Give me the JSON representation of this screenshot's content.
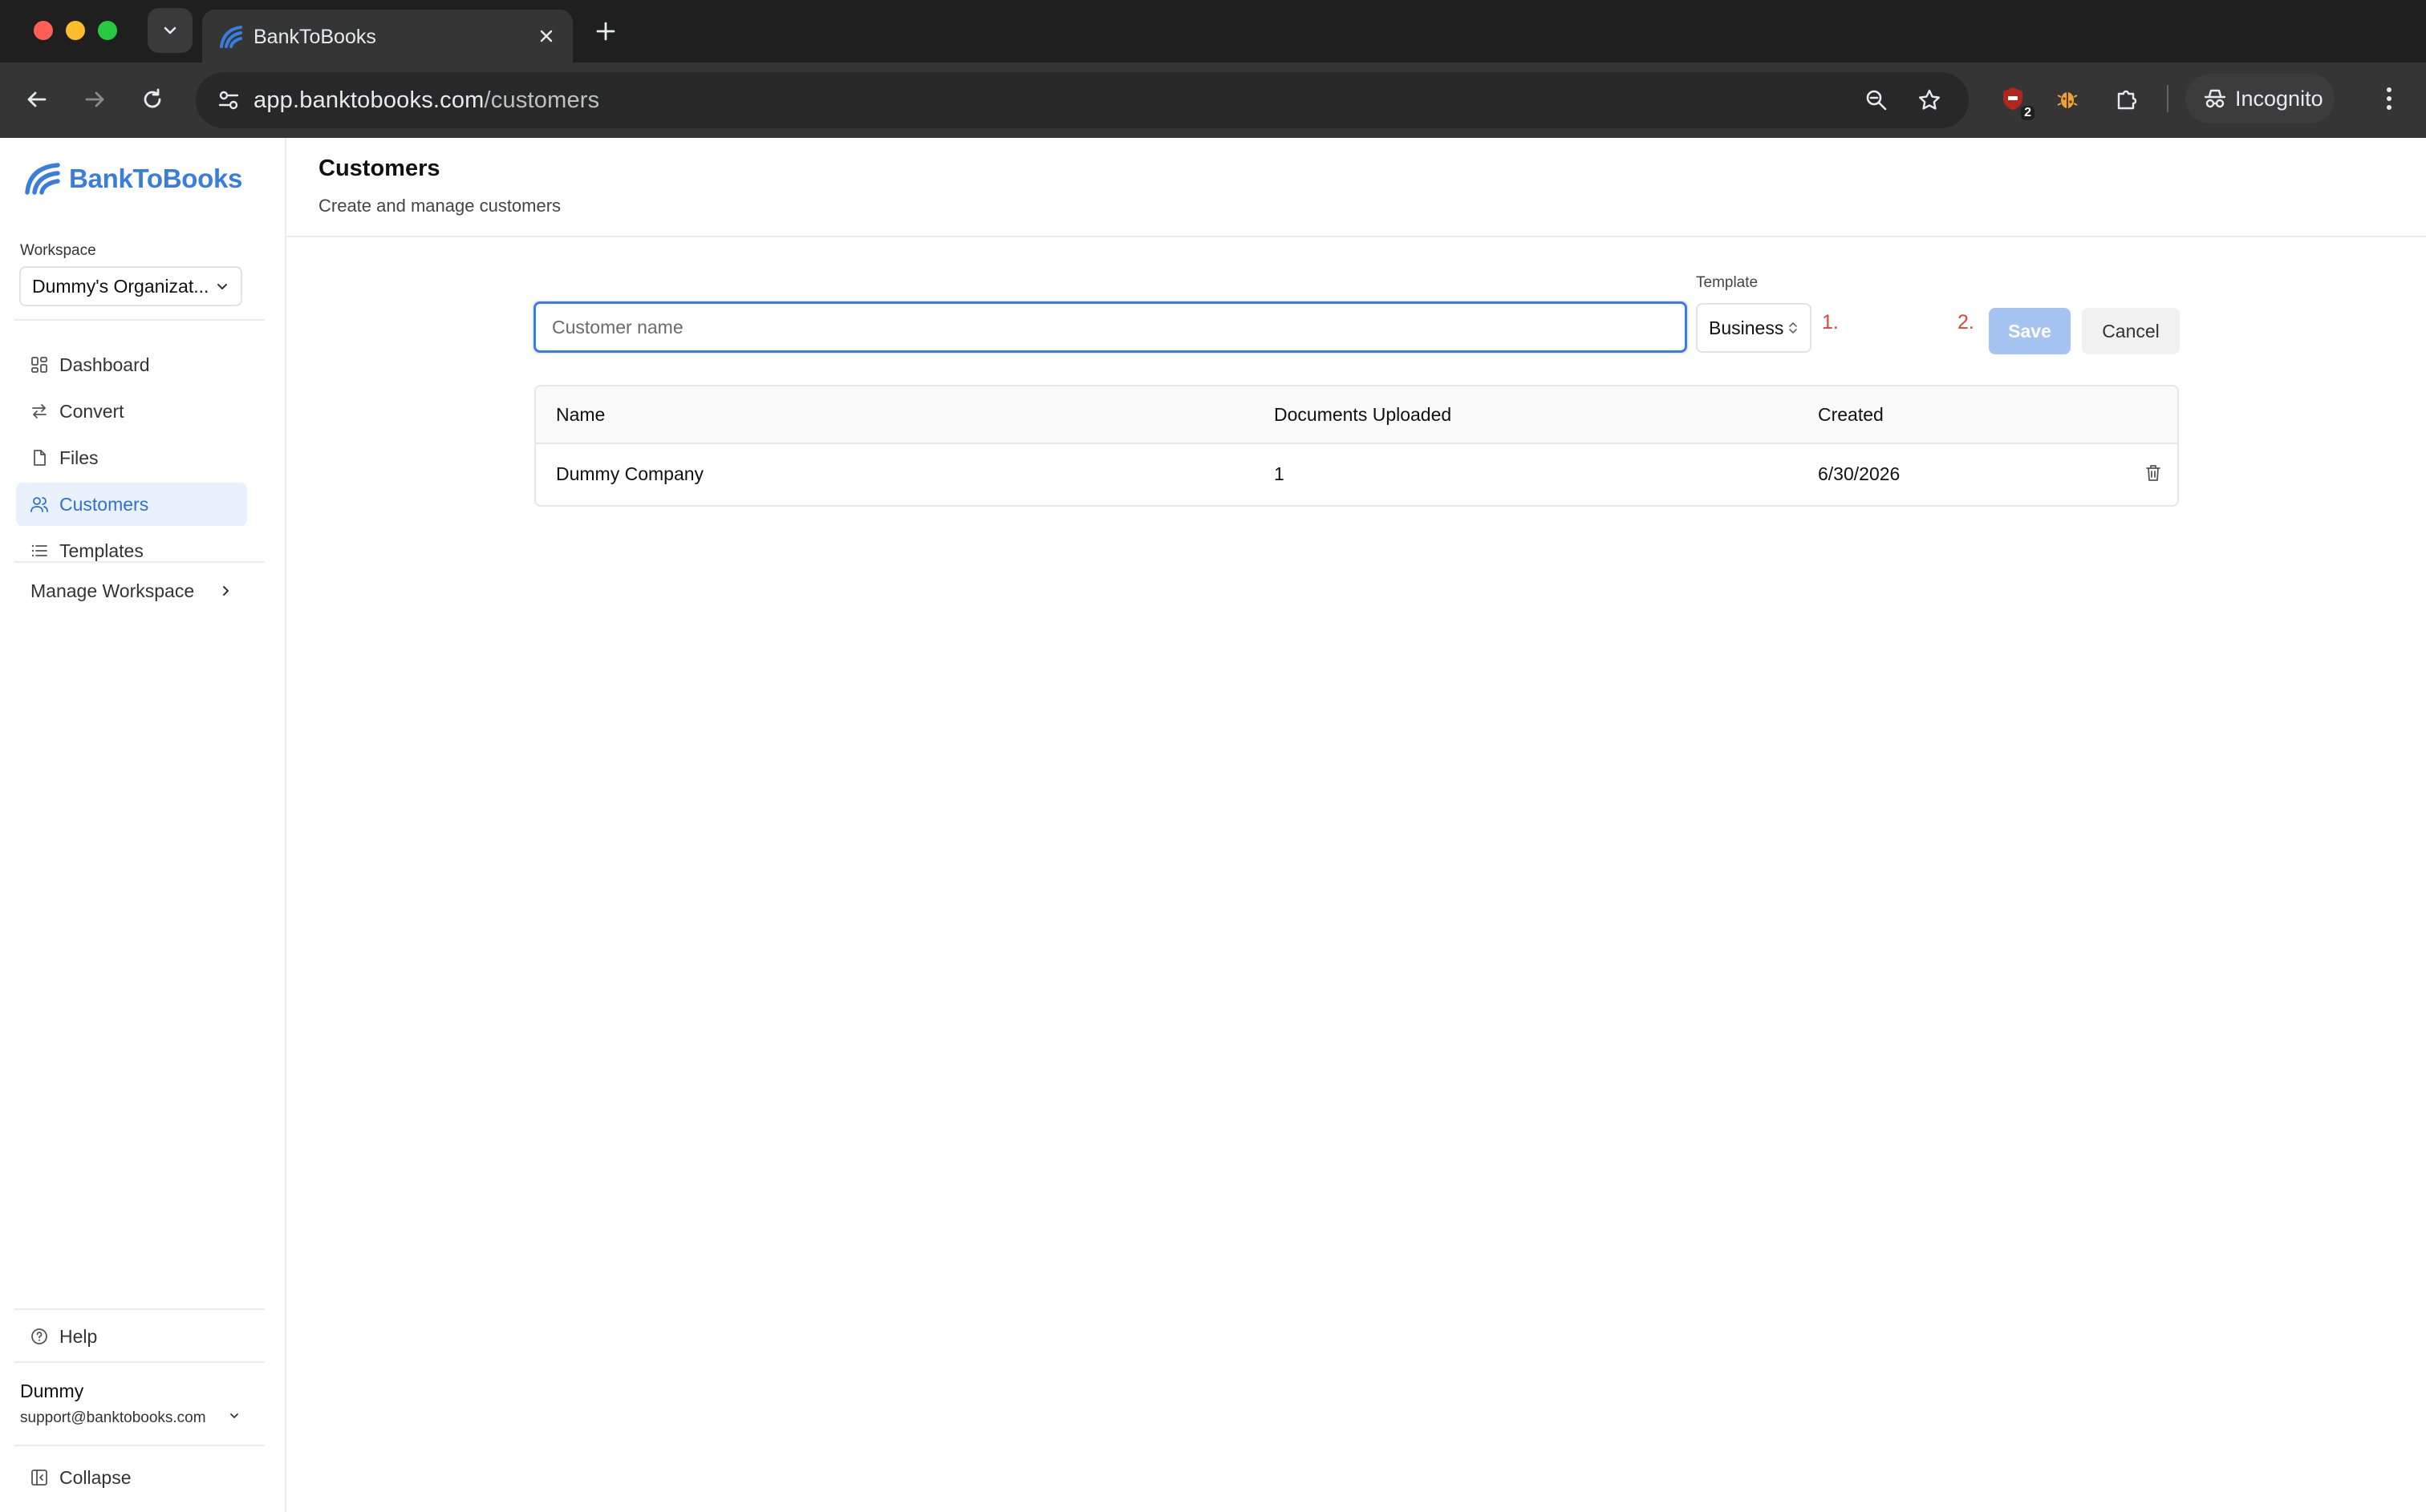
{
  "browser": {
    "tab_title": "BankToBooks",
    "url_host": "app.banktobooks.com",
    "url_path": "/customers",
    "extension_badge": "2",
    "incognito_label": "Incognito"
  },
  "sidebar": {
    "brand": "BankToBooks",
    "workspace_label": "Workspace",
    "workspace_value": "Dummy's Organizat...",
    "items": [
      {
        "label": "Dashboard",
        "icon": "dashboard-icon"
      },
      {
        "label": "Convert",
        "icon": "convert-icon"
      },
      {
        "label": "Files",
        "icon": "file-icon"
      },
      {
        "label": "Customers",
        "icon": "users-icon",
        "active": true
      },
      {
        "label": "Templates",
        "icon": "list-icon"
      }
    ],
    "manage_workspace": "Manage Workspace",
    "help": "Help",
    "user_name": "Dummy",
    "user_email": "support@banktobooks.com",
    "collapse": "Collapse"
  },
  "header": {
    "title": "Customers",
    "subtitle": "Create and manage customers"
  },
  "form": {
    "name_placeholder": "Customer name",
    "name_value": "",
    "template_label": "Template",
    "template_value": "Business",
    "annotation_1": "1.",
    "annotation_2": "2.",
    "save_label": "Save",
    "cancel_label": "Cancel"
  },
  "table": {
    "columns": [
      "Name",
      "Documents Uploaded",
      "Created"
    ],
    "rows": [
      {
        "name": "Dummy Company",
        "documents": "1",
        "created": "6/30/2026"
      }
    ]
  },
  "colors": {
    "accent": "#3b7ddd",
    "active_bg": "#e9f1fd",
    "annotation": "#e0453a",
    "save_disabled": "#a6c4f1"
  }
}
